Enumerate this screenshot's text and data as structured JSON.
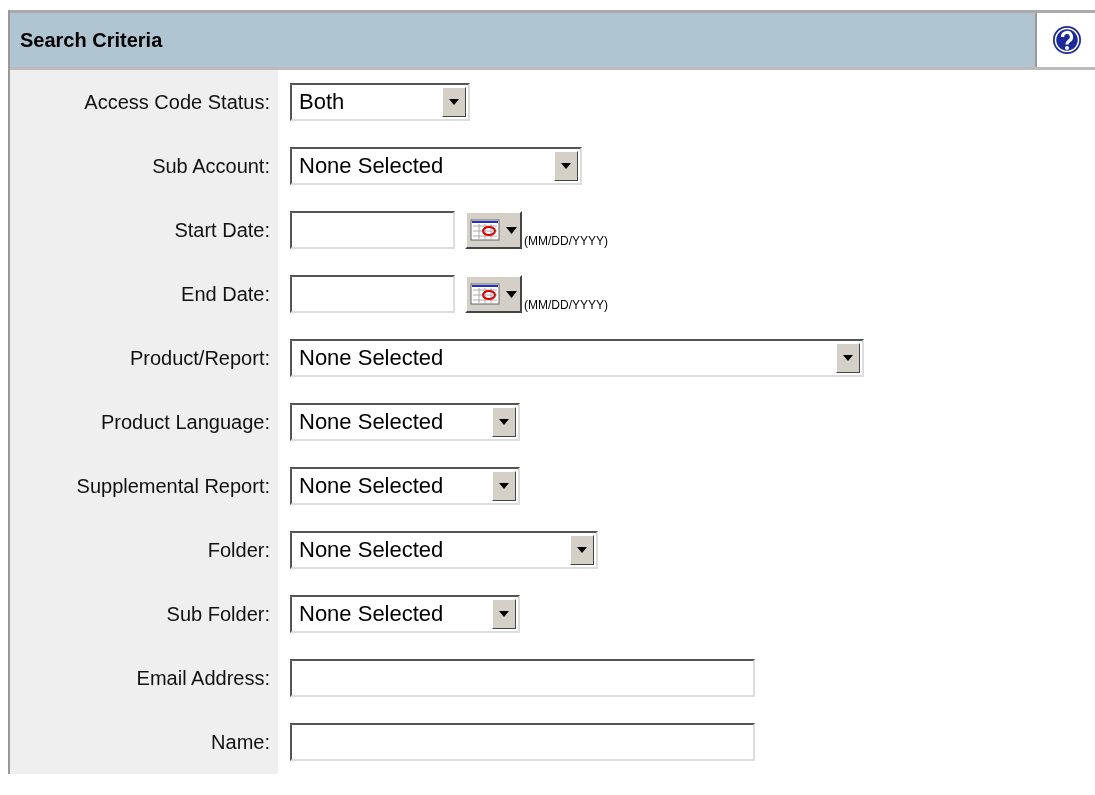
{
  "panel": {
    "title": "Search Criteria"
  },
  "fields": [
    {
      "label": "Access Code Status:",
      "kind": "select",
      "value": "Both"
    },
    {
      "label": "Sub Account:",
      "kind": "select",
      "value": "None Selected"
    },
    {
      "label": "Start Date:",
      "kind": "date",
      "hint": "(MM/DD/YYYY)"
    },
    {
      "label": "End Date:",
      "kind": "date",
      "hint": "(MM/DD/YYYY)"
    },
    {
      "label": "Product/Report:",
      "kind": "select",
      "value": "None Selected"
    },
    {
      "label": "Product Language:",
      "kind": "select",
      "value": "None Selected"
    },
    {
      "label": "Supplemental Report:",
      "kind": "select",
      "value": "None Selected"
    },
    {
      "label": "Folder:",
      "kind": "select",
      "value": "None Selected"
    },
    {
      "label": "Sub Folder:",
      "kind": "select",
      "value": "None Selected"
    },
    {
      "label": "Email Address:",
      "kind": "text"
    },
    {
      "label": "Name:",
      "kind": "text"
    }
  ]
}
